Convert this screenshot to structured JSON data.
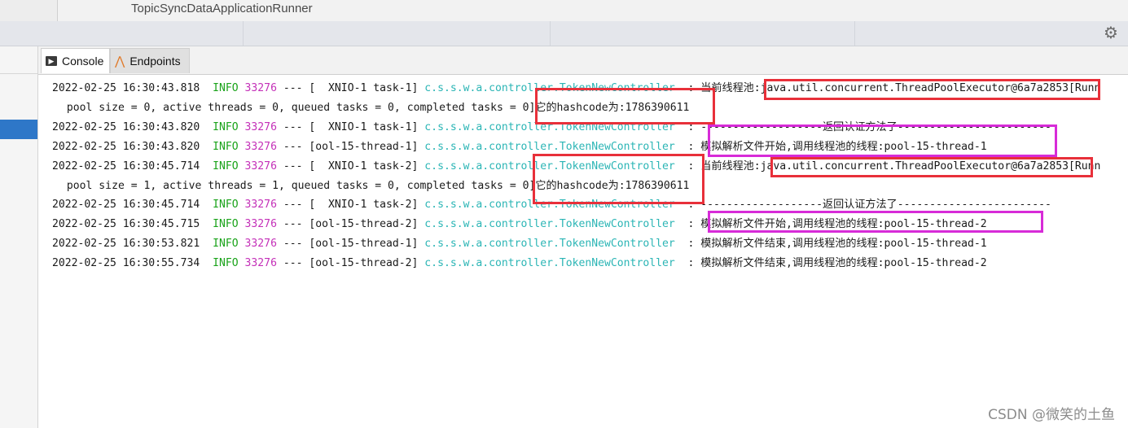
{
  "window": {
    "run_config": "TopicSyncDataApplicationRunner"
  },
  "tool_tabs": [
    {
      "label": "Console",
      "icon": "console-icon"
    },
    {
      "label": "Endpoints",
      "icon": "endpoints-icon"
    }
  ],
  "colors": {
    "info": "#1aa31a",
    "pid": "#c430b8",
    "logger": "#2bb5b5",
    "red_box": "#e8303a",
    "magenta_box": "#d72bd8",
    "selection": "#2e77c8"
  },
  "log": [
    {
      "ts": "2022-02-25 16:30:43.818",
      "level": "INFO",
      "pid": "33276",
      "sep": "---",
      "thread": "[  XNIO-1 task-1]",
      "logger": "c.s.s.w.a.controller.TokenNewController",
      "msg": "  : 当前线程池:java.util.concurrent.ThreadPoolExecutor@6a7a2853[Runn"
    },
    {
      "cont": " pool size = 0, active threads = 0, queued tasks = 0, completed tasks = 0]它的hashcode为:1786390611"
    },
    {
      "ts": "2022-02-25 16:30:43.820",
      "level": "INFO",
      "pid": "33276",
      "sep": "---",
      "thread": "[  XNIO-1 task-1]",
      "logger": "c.s.s.w.a.controller.TokenNewController",
      "msg": "  : -------------------返回认证方法了------------------------"
    },
    {
      "ts": "2022-02-25 16:30:43.820",
      "level": "INFO",
      "pid": "33276",
      "sep": "---",
      "thread": "[ool-15-thread-1]",
      "logger": "c.s.s.w.a.controller.TokenNewController",
      "msg": "  : 模拟解析文件开始,调用线程池的线程:pool-15-thread-1"
    },
    {
      "ts": "2022-02-25 16:30:45.714",
      "level": "INFO",
      "pid": "33276",
      "sep": "---",
      "thread": "[  XNIO-1 task-2]",
      "logger": "c.s.s.w.a.controller.TokenNewController",
      "msg": "  : 当前线程池:java.util.concurrent.ThreadPoolExecutor@6a7a2853[Runn"
    },
    {
      "cont": " pool size = 1, active threads = 1, queued tasks = 0, completed tasks = 0]它的hashcode为:1786390611"
    },
    {
      "ts": "2022-02-25 16:30:45.714",
      "level": "INFO",
      "pid": "33276",
      "sep": "---",
      "thread": "[  XNIO-1 task-2]",
      "logger": "c.s.s.w.a.controller.TokenNewController",
      "msg": "  : -------------------返回认证方法了------------------------"
    },
    {
      "ts": "2022-02-25 16:30:45.715",
      "level": "INFO",
      "pid": "33276",
      "sep": "---",
      "thread": "[ool-15-thread-2]",
      "logger": "c.s.s.w.a.controller.TokenNewController",
      "msg": "  : 模拟解析文件开始,调用线程池的线程:pool-15-thread-2"
    },
    {
      "ts": "2022-02-25 16:30:53.821",
      "level": "INFO",
      "pid": "33276",
      "sep": "---",
      "thread": "[ool-15-thread-1]",
      "logger": "c.s.s.w.a.controller.TokenNewController",
      "msg": "  : 模拟解析文件结束,调用线程池的线程:pool-15-thread-1"
    },
    {
      "ts": "2022-02-25 16:30:55.734",
      "level": "INFO",
      "pid": "33276",
      "sep": "---",
      "thread": "[ool-15-thread-2]",
      "logger": "c.s.s.w.a.controller.TokenNewController",
      "msg": "  : 模拟解析文件结束,调用线程池的线程:pool-15-thread-2"
    }
  ],
  "watermark": "CSDN @微笑的土鱼"
}
